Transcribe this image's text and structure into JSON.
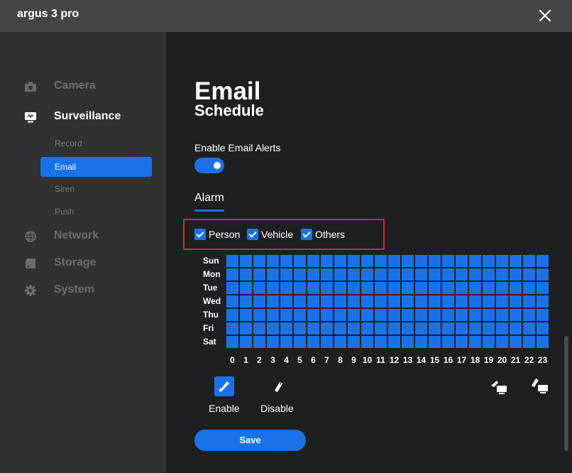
{
  "window": {
    "title": "argus 3 pro",
    "close_icon": "close-icon"
  },
  "sidebar": {
    "items": [
      {
        "label": "Camera",
        "icon": "camera-icon",
        "active": false
      },
      {
        "label": "Surveillance",
        "icon": "monitor-icon",
        "active": true
      },
      {
        "label": "Network",
        "icon": "globe-icon",
        "active": false
      },
      {
        "label": "Storage",
        "icon": "storage-icon",
        "active": false
      },
      {
        "label": "System",
        "icon": "gear-icon",
        "active": false
      }
    ],
    "sub_items": [
      {
        "label": "Record",
        "active": false
      },
      {
        "label": "Email",
        "active": true
      },
      {
        "label": "Siren",
        "active": false
      },
      {
        "label": "Push",
        "active": false
      }
    ]
  },
  "main": {
    "title": "Email",
    "section_partial": "Schedule",
    "enable_label": "Enable Email Alerts",
    "enable_on": true,
    "tab": "Alarm",
    "checks": [
      {
        "label": "Person",
        "checked": true
      },
      {
        "label": "Vehicle",
        "checked": true
      },
      {
        "label": "Others",
        "checked": true
      }
    ],
    "schedule": {
      "days": [
        "Sun",
        "Mon",
        "Tue",
        "Wed",
        "Thu",
        "Fri",
        "Sat"
      ],
      "hours": [
        "0",
        "1",
        "2",
        "3",
        "4",
        "5",
        "6",
        "7",
        "8",
        "9",
        "10",
        "11",
        "12",
        "13",
        "14",
        "15",
        "16",
        "17",
        "18",
        "19",
        "20",
        "21",
        "22",
        "23"
      ],
      "all_enabled": true
    },
    "tools": {
      "enable": "Enable",
      "disable": "Disable"
    },
    "save": "Save"
  },
  "colors": {
    "accent": "#1a72e8",
    "highlight": "#e0262b",
    "sidebar_bg": "#303133",
    "content_bg": "#1e1f20",
    "titlebar_bg": "#444546"
  }
}
